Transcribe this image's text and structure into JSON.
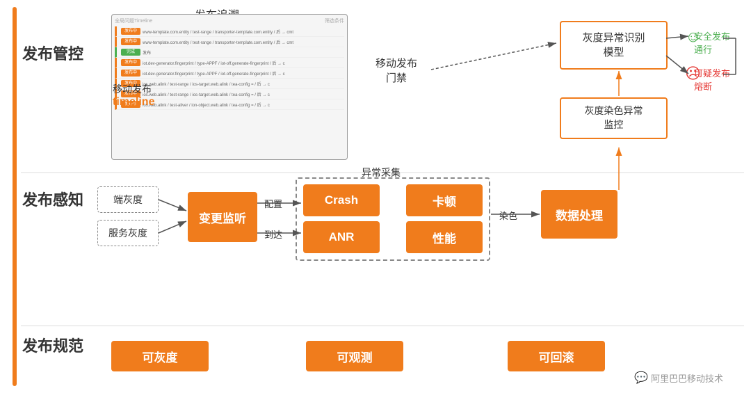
{
  "sections": {
    "guankong": "发布管控",
    "ganzhi": "发布感知",
    "guifan": "发布规范"
  },
  "top": {
    "trace_title": "发布追溯",
    "timeline_label": "移动发布",
    "timeline_sublabel": "timeline",
    "mogate_label": "移动发布\n门禁",
    "gray_model_label": "灰度异常识别\n模型",
    "gray_color_label": "灰度染色异常\n监控",
    "outcome_pass": "安全发布\n通行",
    "outcome_block": "可疑发布\n熔断",
    "table_header": "全局问题Timeline",
    "table_hint": "筛选条件"
  },
  "middle": {
    "duan_gray": "端灰度",
    "server_gray": "服务灰度",
    "change_monitor": "变更监听",
    "config_label": "配置",
    "arrive_label": "到达",
    "anomaly_collect_title": "异常采集",
    "crash_label": "Crash",
    "kadun_label": "卡顿",
    "anr_label": "ANR",
    "perf_label": "性能",
    "dyeing_label": "染色",
    "data_process_label": "数据处理"
  },
  "bottom": {
    "norm1": "可灰度",
    "norm2": "可观测",
    "norm3": "可回滚",
    "ali_logo": "阿里巴巴移动技术"
  },
  "trace_rows": [
    {
      "type": "orange",
      "tag": "发布中",
      "text": "www-template.com.entity / test-range / transporter-template.com.entity / 后 → cmt"
    },
    {
      "type": "orange",
      "tag": "发布中",
      "text": "www-template.com.entity / test-range / transporter-template.com.entity / 后 → cmt"
    },
    {
      "type": "green",
      "tag": "完成",
      "text": "发布"
    },
    {
      "type": "orange",
      "tag": "发布中",
      "text": "iot.dev-generator.fingerprint / type-APPF / iot-off.generate-fingerprint / 后 → c"
    },
    {
      "type": "orange",
      "tag": "发布中",
      "text": "iot.dev-generator.fingerprint / type-APPF / iot-off.generate-fingerprint / 后 → c"
    },
    {
      "type": "orange",
      "tag": "发布中",
      "text": "ios.web.alink / test-range / ios-target.web.alink / tea-config = / 后 → c"
    },
    {
      "type": "orange",
      "tag": "发布中",
      "text": "ios.web.alink / test-range / ios-target.web.alink / tea-config = / 后 → c"
    },
    {
      "type": "orange",
      "tag": "发布中",
      "text": "ios.web.alink / test-aliver / ion-object.web.alink / tea-config = / 后 → c"
    }
  ]
}
